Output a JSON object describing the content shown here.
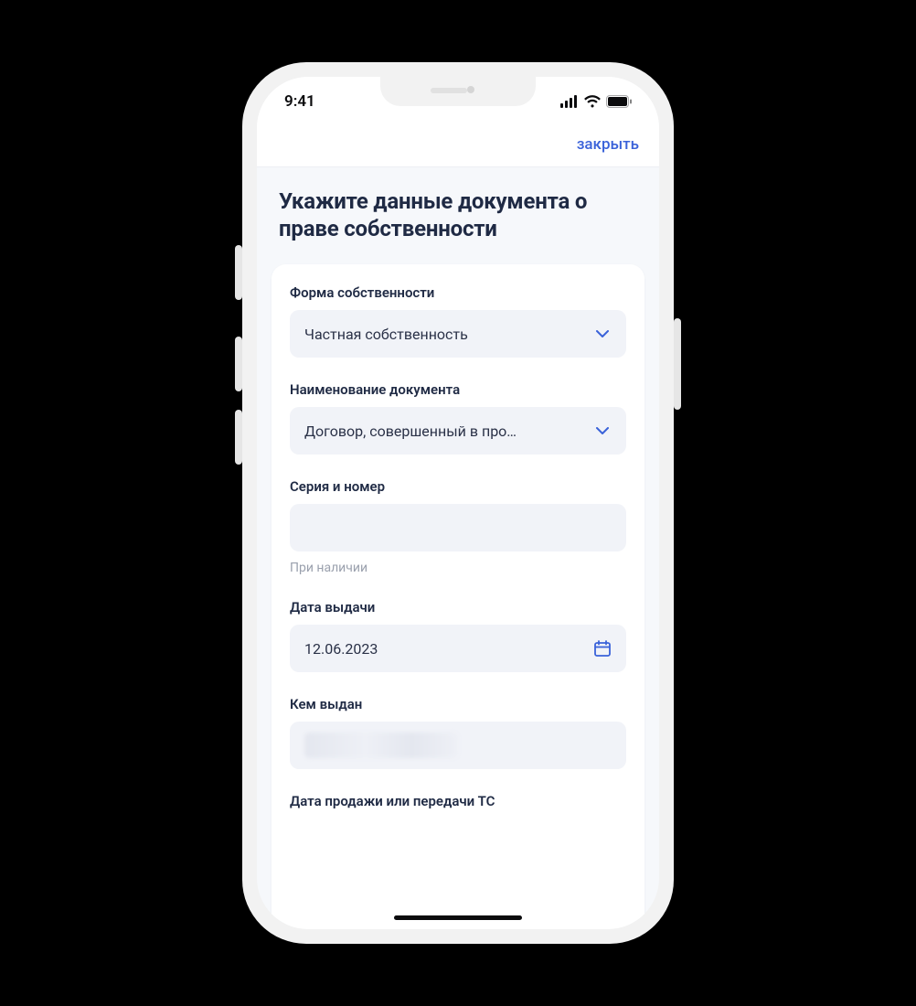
{
  "status": {
    "time": "9:41"
  },
  "nav": {
    "close_label": "закрыть"
  },
  "title": "Укажите данные документа о праве собственности",
  "fields": {
    "ownership_form": {
      "label": "Форма собственности",
      "value": "Частная собственность"
    },
    "document_name": {
      "label": "Наименование документа",
      "value": "Договор, совершенный в про…"
    },
    "series_number": {
      "label": "Серия и номер",
      "value": "",
      "hint": "При наличии"
    },
    "issue_date": {
      "label": "Дата выдачи",
      "value": "12.06.2023"
    },
    "issued_by": {
      "label": "Кем выдан",
      "value": ""
    },
    "sale_date": {
      "label": "Дата продажи или передачи ТС"
    }
  },
  "colors": {
    "accent": "#3a62d9",
    "text_primary": "#1f2a44",
    "text_secondary": "#9aa0ad",
    "control_bg": "#f1f3f8",
    "page_bg": "#f6f8fb"
  }
}
